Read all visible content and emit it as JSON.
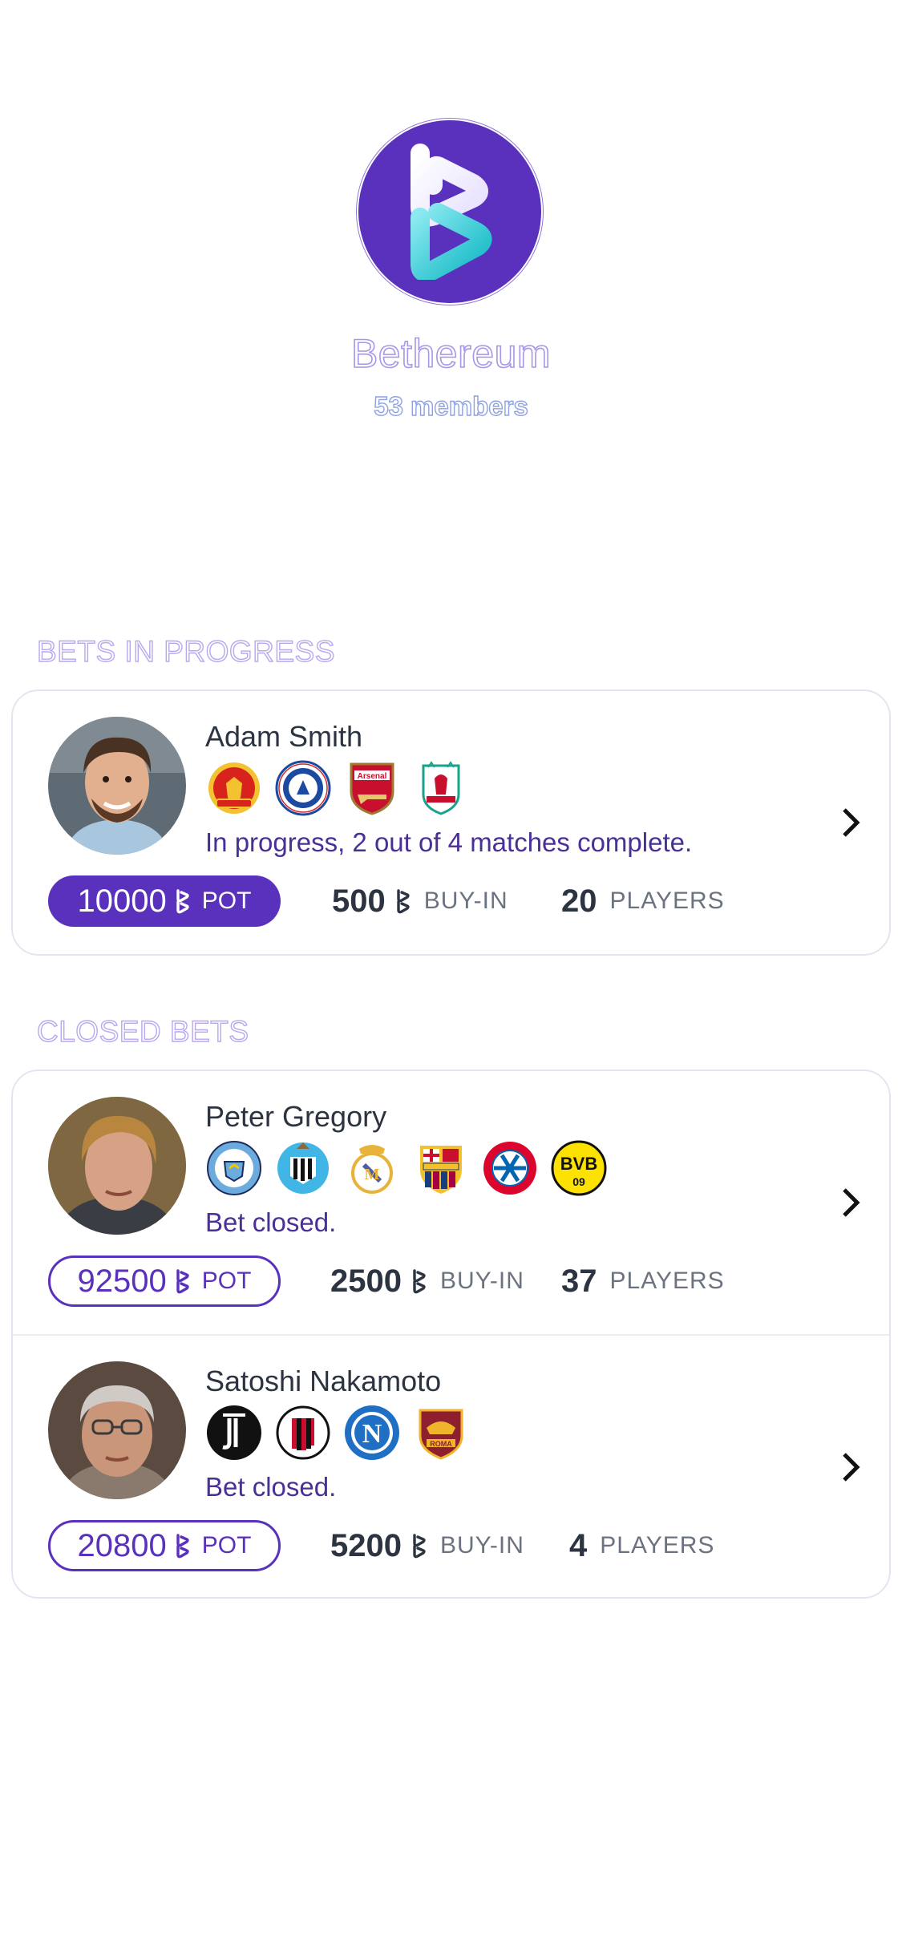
{
  "group": {
    "name": "Bethereum",
    "members": "53 members",
    "logo_icon": "bethereum-logo-icon",
    "brand_color": "#5a31bd",
    "accent_color": "#2dd4d4"
  },
  "sections": {
    "in_progress_title": "BETS IN PROGRESS",
    "closed_title": "CLOSED BETS"
  },
  "bets_in_progress": [
    {
      "name": "Adam Smith",
      "status": "In progress, 2 out of 4 matches complete.",
      "pot": "10000",
      "pot_label": "POT",
      "buyin": "500",
      "buyin_label": "BUY-IN",
      "players": "20",
      "players_label": "PLAYERS",
      "teams": [
        "Manchester United",
        "Chelsea",
        "Arsenal",
        "Liverpool"
      ]
    }
  ],
  "closed_bets": [
    {
      "name": "Peter Gregory",
      "status": "Bet closed.",
      "pot": "92500",
      "pot_label": "POT",
      "buyin": "2500",
      "buyin_label": "BUY-IN",
      "players": "37",
      "players_label": "PLAYERS",
      "teams": [
        "Manchester City",
        "Newcastle United",
        "Real Madrid",
        "FC Barcelona",
        "FC Bayern München",
        "BVB 09"
      ]
    },
    {
      "name": "Satoshi Nakamoto",
      "status": "Bet closed.",
      "pot": "20800",
      "pot_label": "POT",
      "buyin": "5200",
      "buyin_label": "BUY-IN",
      "players": "4",
      "players_label": "PLAYERS",
      "teams": [
        "Juventus",
        "AC Milan",
        "Napoli",
        "AS Roma"
      ]
    }
  ]
}
